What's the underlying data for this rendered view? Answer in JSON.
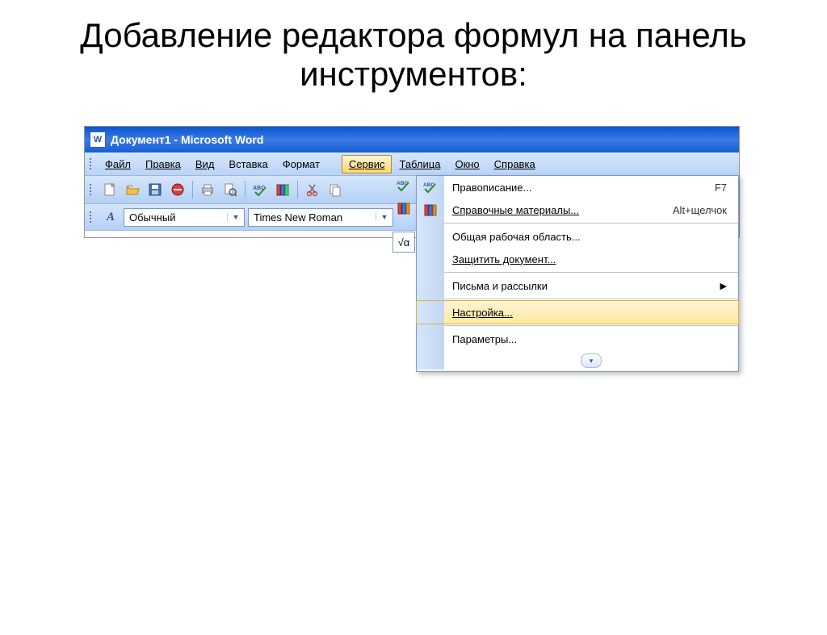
{
  "slide": {
    "title": "Добавление редактора формул на панель инструментов:"
  },
  "titlebar": {
    "text": "Документ1 - Microsoft Word"
  },
  "menu": {
    "file": "Файл",
    "edit": "Правка",
    "view": "Вид",
    "insert": "Вставка",
    "format": "Формат",
    "tools": "Сервис",
    "table": "Таблица",
    "window": "Окно",
    "help": "Справка"
  },
  "formatbar": {
    "style": "Обычный",
    "font": "Times New Roman"
  },
  "dropdown": {
    "items": [
      {
        "id": "spelling",
        "label": "Правописание...",
        "shortcut": "F7",
        "icon": "abc-check"
      },
      {
        "id": "research",
        "label": "Справочные материалы...",
        "shortcut": "Alt+щелчок",
        "icon": "books"
      },
      {
        "id": "sep1",
        "separator": true
      },
      {
        "id": "workspace",
        "label": "Общая рабочая область...",
        "shortcut": "",
        "icon": ""
      },
      {
        "id": "protect",
        "label": "Защитить документ...",
        "shortcut": "",
        "icon": ""
      },
      {
        "id": "sep2",
        "separator": true
      },
      {
        "id": "letters",
        "label": "Письма и рассылки",
        "shortcut": "",
        "icon": "",
        "submenu": true
      },
      {
        "id": "sep3",
        "separator": true
      },
      {
        "id": "customize",
        "label": "Настройка...",
        "shortcut": "",
        "icon": "",
        "highlight": true
      },
      {
        "id": "sep4",
        "separator": true
      },
      {
        "id": "options",
        "label": "Параметры...",
        "shortcut": "",
        "icon": ""
      }
    ],
    "sqrt_icon": "√α"
  }
}
